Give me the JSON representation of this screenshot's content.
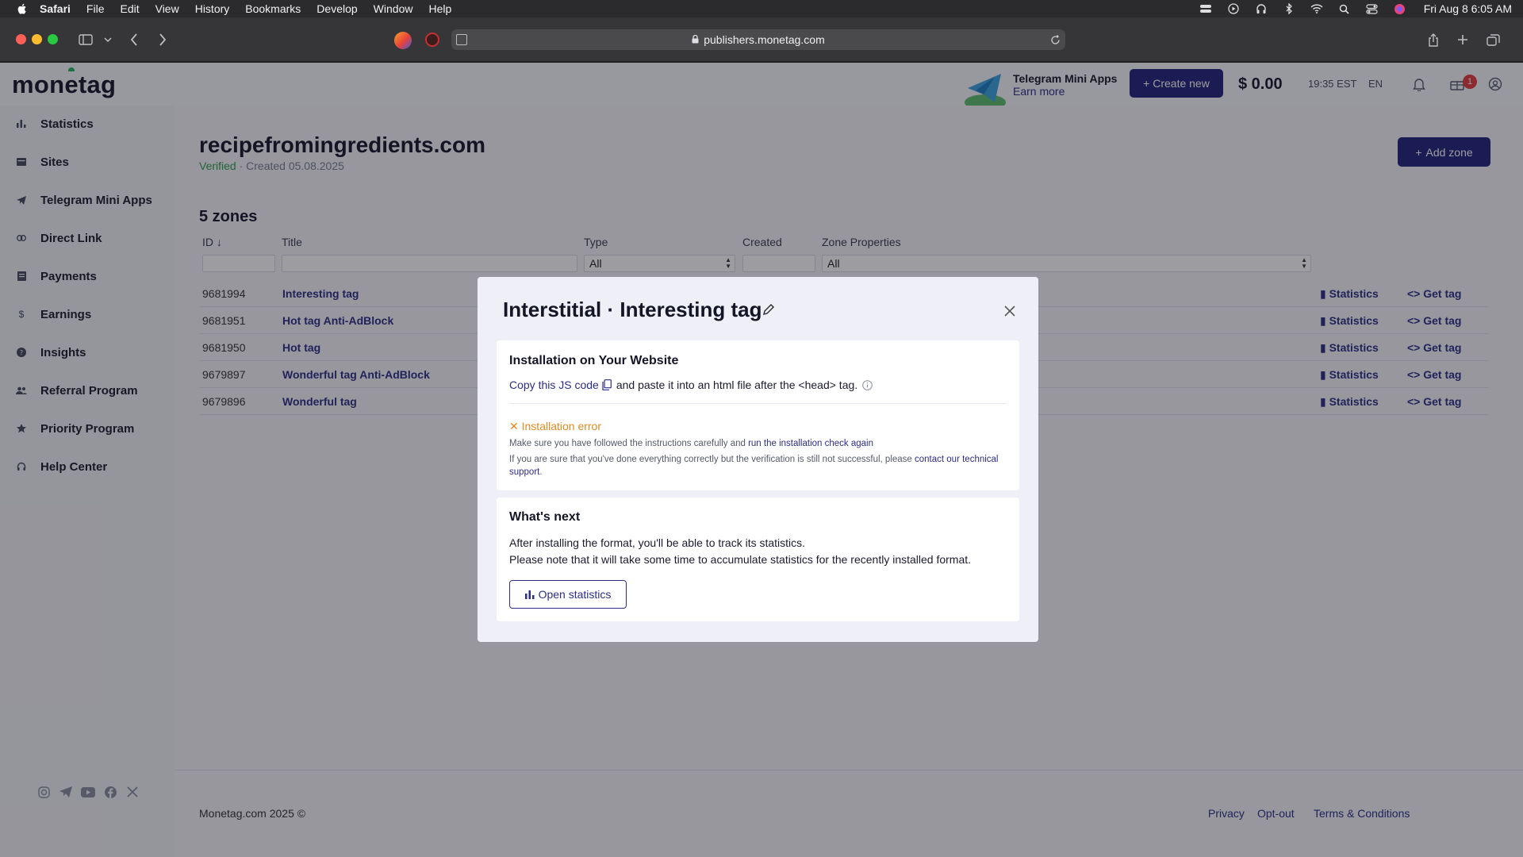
{
  "menubar": {
    "app": "Safari",
    "items": [
      "File",
      "Edit",
      "View",
      "History",
      "Bookmarks",
      "Develop",
      "Window",
      "Help"
    ],
    "datetime": "Fri Aug 8  6:05 AM"
  },
  "browser": {
    "url": "publishers.monetag.com"
  },
  "header": {
    "logo": "monetag",
    "promo_title": "Telegram Mini Apps",
    "promo_sub": "Earn more",
    "create_label": "+ Create new",
    "balance": "$ 0.00",
    "time": "19:35 EST",
    "lang": "EN",
    "notification_count": "1"
  },
  "sidebar": {
    "items": [
      {
        "label": "Statistics",
        "icon": "bar-chart-icon"
      },
      {
        "label": "Sites",
        "icon": "sites-icon"
      },
      {
        "label": "Telegram Mini Apps",
        "icon": "telegram-icon"
      },
      {
        "label": "Direct Link",
        "icon": "link-icon"
      },
      {
        "label": "Payments",
        "icon": "payments-icon"
      },
      {
        "label": "Earnings",
        "icon": "dollar-icon"
      },
      {
        "label": "Insights",
        "icon": "question-icon"
      },
      {
        "label": "Referral Program",
        "icon": "users-icon"
      },
      {
        "label": "Priority Program",
        "icon": "star-icon"
      },
      {
        "label": "Help Center",
        "icon": "headset-icon"
      }
    ]
  },
  "main": {
    "site_title": "recipefromingredients.com",
    "verified": "Verified",
    "created": "· Created 05.08.2025",
    "add_zone": "Add zone",
    "zones_count": "5 zones",
    "columns": {
      "id": "ID",
      "title": "Title",
      "type": "Type",
      "created": "Created",
      "props": "Zone Properties"
    },
    "filters": {
      "type": "All",
      "props": "All"
    },
    "rows": [
      {
        "id": "9681994",
        "title": "Interesting tag",
        "stats": "Statistics",
        "get": "Get tag"
      },
      {
        "id": "9681951",
        "title": "Hot tag Anti-AdBlock",
        "stats": "Statistics",
        "get": "Get tag"
      },
      {
        "id": "9681950",
        "title": "Hot tag",
        "stats": "Statistics",
        "get": "Get tag"
      },
      {
        "id": "9679897",
        "title": "Wonderful tag Anti-AdBlock",
        "stats": "Statistics",
        "get": "Get tag"
      },
      {
        "id": "9679896",
        "title": "Wonderful tag",
        "stats": "Statistics",
        "get": "Get tag"
      }
    ]
  },
  "footer": {
    "copyright": "Monetag.com 2025 ©",
    "links": [
      "Privacy",
      "Opt-out",
      "Terms & Conditions"
    ]
  },
  "modal": {
    "title": "Interstitial · Interesting tag",
    "install": {
      "heading": "Installation on Your Website",
      "copy_link": "Copy this JS code",
      "instruction": "and paste it into an html file after the <head> tag.",
      "error": "Installation error",
      "note1_pre": "Make sure you have followed the instructions carefully and ",
      "note1_link": "run the installation check again",
      "note2_pre": "If you are sure that you've done everything correctly but the verification is still not successful, please ",
      "note2_link": "contact our technical support",
      "note2_post": "."
    },
    "next": {
      "heading": "What's next",
      "line1": "After installing the format, you'll be able to track its statistics.",
      "line2": "Please note that it will take some time to accumulate statistics for the recently installed format.",
      "button": "Open statistics"
    }
  }
}
